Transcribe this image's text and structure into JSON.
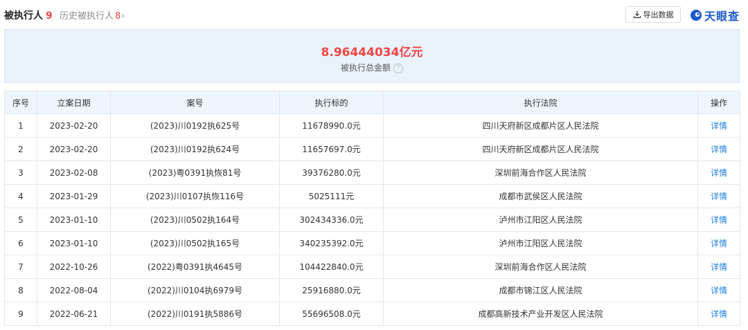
{
  "tabs": {
    "active_label": "被执行人",
    "active_count": "9",
    "history_label": "历史被执行人",
    "history_count": "8",
    "history_chevron": "›"
  },
  "toolbar": {
    "export_label": "导出数据",
    "export_icon": "download-icon"
  },
  "logo": {
    "text": "天眼查",
    "brand_color": "#1d5ac9"
  },
  "summary": {
    "amount": "8.96444034亿元",
    "label": "被执行总金额",
    "help_glyph": "?",
    "amount_color": "#f04646"
  },
  "table": {
    "headers": [
      "序号",
      "立案日期",
      "案号",
      "执行标的",
      "执行法院",
      "操作"
    ],
    "rows": [
      {
        "no": "1",
        "date": "2023-02-20",
        "case_no": "(2023)川0192执625号",
        "amount": "11678990.0元",
        "court": "四川天府新区成都片区人民法院",
        "action": "详情"
      },
      {
        "no": "2",
        "date": "2023-02-20",
        "case_no": "(2023)川0192执624号",
        "amount": "11657697.0元",
        "court": "四川天府新区成都片区人民法院",
        "action": "详情"
      },
      {
        "no": "3",
        "date": "2023-02-08",
        "case_no": "(2023)粤0391执恢81号",
        "amount": "39376280.0元",
        "court": "深圳前海合作区人民法院",
        "action": "详情"
      },
      {
        "no": "4",
        "date": "2023-01-29",
        "case_no": "(2023)川0107执恢116号",
        "amount": "5025111元",
        "court": "成都市武侯区人民法院",
        "action": "详情"
      },
      {
        "no": "5",
        "date": "2023-01-10",
        "case_no": "(2023)川0502执164号",
        "amount": "302434336.0元",
        "court": "泸州市江阳区人民法院",
        "action": "详情"
      },
      {
        "no": "6",
        "date": "2023-01-10",
        "case_no": "(2023)川0502执165号",
        "amount": "340235392.0元",
        "court": "泸州市江阳区人民法院",
        "action": "详情"
      },
      {
        "no": "7",
        "date": "2022-10-26",
        "case_no": "(2022)粤0391执4645号",
        "amount": "104422840.0元",
        "court": "深圳前海合作区人民法院",
        "action": "详情"
      },
      {
        "no": "8",
        "date": "2022-08-04",
        "case_no": "(2022)川0104执6979号",
        "amount": "25916880.0元",
        "court": "成都市锦江区人民法院",
        "action": "详情"
      },
      {
        "no": "9",
        "date": "2022-06-21",
        "case_no": "(2022)川0191执5886号",
        "amount": "55696508.0元",
        "court": "成都高新技术产业开发区人民法院",
        "action": "详情"
      }
    ]
  }
}
